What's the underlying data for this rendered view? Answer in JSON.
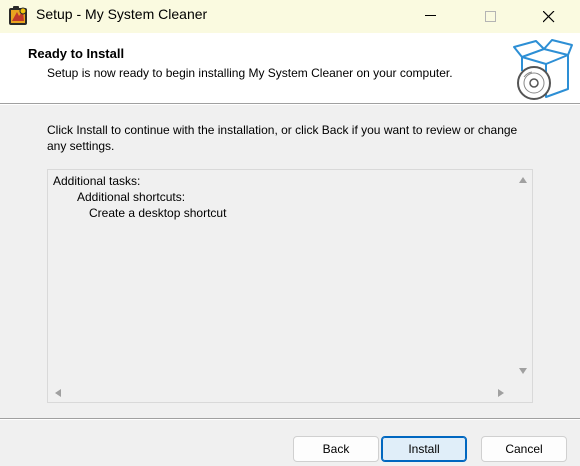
{
  "window": {
    "title": "Setup - My System Cleaner",
    "icons": {
      "app": "app-installer-icon",
      "minimize": "minimize-icon",
      "maximize": "maximize-icon",
      "close": "close-icon"
    }
  },
  "header": {
    "title": "Ready to Install",
    "subtitle": "Setup is now ready to begin installing My System Cleaner on your computer.",
    "graphic": "software-box-disc-icon"
  },
  "body": {
    "intro": "Click Install to continue with the installation, or click Back if you want to review or change any settings.",
    "memo_lines": [
      "Additional tasks:",
      "Additional shortcuts:",
      "Create a desktop shortcut"
    ]
  },
  "buttons": {
    "back": "Back",
    "install": "Install",
    "cancel": "Cancel"
  },
  "colors": {
    "titlebar_bg": "#fafae0",
    "dialog_bg": "#f0f0f0",
    "header_bg": "#ffffff",
    "default_button_border": "#0067c0",
    "graphic_blue": "#2d8fd5"
  }
}
